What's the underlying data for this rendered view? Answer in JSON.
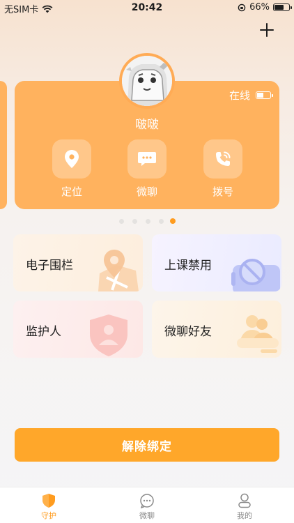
{
  "status_bar": {
    "carrier": "无SIM卡",
    "time": "20:42",
    "battery": "66%",
    "battery_level": 0.66
  },
  "device": {
    "name": "啵啵",
    "status": "在线",
    "battery_level": 0.55
  },
  "card_actions": [
    {
      "label": "定位",
      "icon": "location-pin-icon"
    },
    {
      "label": "微聊",
      "icon": "chat-bubble-icon"
    },
    {
      "label": "拨号",
      "icon": "phone-icon"
    }
  ],
  "carousel": {
    "page_count": 5,
    "active_index": 4
  },
  "features": {
    "fence": {
      "label": "电子围栏",
      "icon": "map-pin-icon"
    },
    "class_ban": {
      "label": "上课禁用",
      "icon": "no-tv-icon"
    },
    "guardian": {
      "label": "监护人",
      "icon": "shield-user-icon"
    },
    "friends": {
      "label": "微聊好友",
      "icon": "friends-icon"
    }
  },
  "unbind_label": "解除绑定",
  "tabs": [
    {
      "label": "守护",
      "icon": "shield-icon",
      "active": true
    },
    {
      "label": "微聊",
      "icon": "chat-icon",
      "active": false
    },
    {
      "label": "我的",
      "icon": "profile-icon",
      "active": false
    }
  ],
  "colors": {
    "accent": "#ff9c1f",
    "card": "#ffb25e",
    "button": "#ffa72a"
  }
}
